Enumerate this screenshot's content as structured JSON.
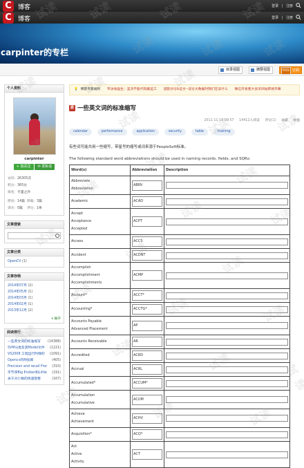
{
  "topbar1": {
    "brand": "博客",
    "links": [
      "登录",
      "注册"
    ]
  },
  "topbar2": {
    "brand": "博客",
    "links": [
      "登录",
      "注册"
    ]
  },
  "banner": {
    "title": "carpinter的专栏"
  },
  "toolbar": {
    "catalog": "目录视图",
    "summary": "摘要视图",
    "rss": "RSS",
    "rss_label": "订阅"
  },
  "profile": {
    "header": "个人资料",
    "name": "carpinter",
    "follow": "加关注",
    "message": "发私信",
    "stats": {
      "visits_label": "访问:",
      "visits": "26305次",
      "points_label": "积分:",
      "points": "365分",
      "rank_label": "排名:",
      "rank": "千里之外",
      "original_label": "原创:",
      "original": "14篇",
      "repost_label": "转载:",
      "repost": "3篇",
      "translate_label": "译文:",
      "translate": "0篇",
      "comment_label": "评论:",
      "comment": "1条"
    }
  },
  "search": {
    "header": "文章搜索"
  },
  "categories": {
    "header": "文章分类",
    "items": [
      {
        "name": "OpenCV",
        "count": "(1)"
      }
    ]
  },
  "archive": {
    "header": "文章存档",
    "items": [
      {
        "name": "2014年07月",
        "count": "(2)"
      },
      {
        "name": "2014年05月",
        "count": "(1)"
      },
      {
        "name": "2014年03月",
        "count": "(1)"
      },
      {
        "name": "2014年02月",
        "count": "(1)"
      },
      {
        "name": "2013年12月",
        "count": "(2)"
      }
    ],
    "more": "展开"
  },
  "ranking": {
    "header": "阅读排行",
    "items": [
      {
        "name": "一些英文词的标准缩写",
        "count": "(14388)"
      },
      {
        "name": "SVM分类及其Model文件",
        "count": "(1221)"
      },
      {
        "name": "VS2008 工程运行时弹的",
        "count": "(1091)"
      },
      {
        "name": "Opencv的附加库",
        "count": "(405)"
      },
      {
        "name": "Precision and recall Fror",
        "count": "(310)"
      },
      {
        "name": "字节序Big Endian和Little",
        "count": "(191)"
      },
      {
        "name": "关于对小数的快速取整",
        "count": "(167)"
      }
    ]
  },
  "notice": {
    "n1": "博客专家福利",
    "n2": "专访徐晶生：坚决不能代码搬运工",
    "n3": "话题讨论&征文--谈论大数据时我们在谈什么",
    "n4": "微信开发者大会深圳站即将开幕"
  },
  "article": {
    "title": "一些英文词的标准缩写",
    "date": "2011-11-16 09:57",
    "views": "14412人阅读",
    "comments": "评论(1)",
    "collect": "收藏",
    "report": "举报",
    "tags": [
      "calendar",
      "performance",
      "application",
      "security",
      "table",
      "training"
    ],
    "p1": "有些词可能共用一些缩写，带星号的缩写或词来源于PeopleSoft标准。",
    "p2": "The following standard word abbreviations should be used in naming records, fields, and SQRs:",
    "table": {
      "headers": [
        "Word(s)",
        "Abbreviation",
        "Description"
      ],
      "rows": [
        {
          "words": [
            "Abbreviate",
            "Abbreviation"
          ],
          "abbr": "ABRV"
        },
        {
          "words": [
            "Academic"
          ],
          "abbr": "ACAD"
        },
        {
          "words": [
            "Accept",
            "Acceptance",
            "Accepted"
          ],
          "abbr": "ACPT"
        },
        {
          "words": [
            "Access"
          ],
          "abbr": "ACCS"
        },
        {
          "words": [
            "Accident"
          ],
          "abbr": "ACDNT"
        },
        {
          "words": [
            "Accomplish",
            "Accomplishment",
            "Accomplishments"
          ],
          "abbr": "ACMP"
        },
        {
          "words": [
            "Account*"
          ],
          "abbr": "ACCT*"
        },
        {
          "words": [
            "Accounting*"
          ],
          "abbr": "ACCTG*"
        },
        {
          "words": [
            "Accounts Payable",
            "Advanced Placement"
          ],
          "abbr": "AP"
        },
        {
          "words": [
            "Accounts Receivable"
          ],
          "abbr": "AR"
        },
        {
          "words": [
            "Accredited"
          ],
          "abbr": "ACRD"
        },
        {
          "words": [
            "Accrual"
          ],
          "abbr": "ACRL"
        },
        {
          "words": [
            "Accumulated*"
          ],
          "abbr": "ACCUM*"
        },
        {
          "words": [
            "Accumulation",
            "Accumulative"
          ],
          "abbr": "ACUM"
        },
        {
          "words": [
            "Achieve",
            "Achievement"
          ],
          "abbr": "ACHV"
        },
        {
          "words": [
            "Acquisition*"
          ],
          "abbr": "ACQ*"
        },
        {
          "words": [
            "Act",
            "Active",
            "Activity"
          ],
          "abbr": "ACT"
        }
      ]
    }
  },
  "watermark": "试读"
}
